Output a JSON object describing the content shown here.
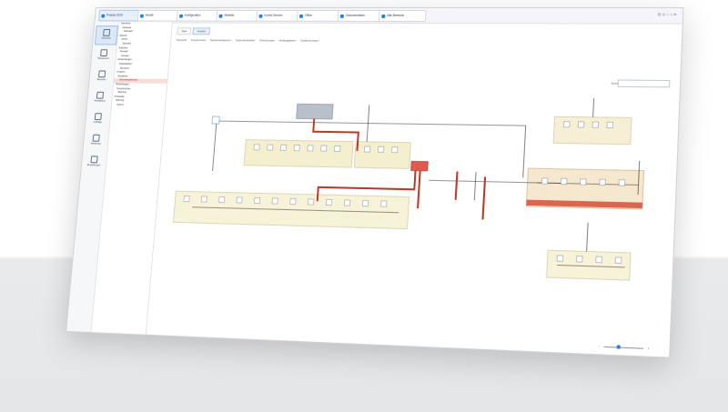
{
  "tabs": [
    {
      "label": "Produkt 2025",
      "active": true
    },
    {
      "label": "Modell"
    },
    {
      "label": "Konfiguration"
    },
    {
      "label": "Website"
    },
    {
      "label": "Kunde Service"
    },
    {
      "label": "Office"
    },
    {
      "label": "Dokumentation"
    },
    {
      "label": "Alle Bereiche"
    }
  ],
  "rail": [
    {
      "label": "Startseite",
      "icon": "home-icon",
      "selected": true
    },
    {
      "label": "Ressourcen",
      "icon": "grid-icon"
    },
    {
      "label": "Benutzer",
      "icon": "user-icon"
    },
    {
      "label": "Verwaltung",
      "icon": "folder-icon"
    },
    {
      "label": "Aufträge",
      "icon": "list-icon"
    },
    {
      "label": "Werkzeug",
      "icon": "tool-icon"
    },
    {
      "label": "Einstellungen",
      "icon": "gear-icon"
    }
  ],
  "tree": [
    {
      "label": "Standorte"
    },
    {
      "label": "Gebäude"
    },
    {
      "label": "Netzwerk"
    },
    {
      "label": "Räume"
    },
    {
      "label": "Server"
    },
    {
      "label": "Speicher"
    },
    {
      "label": "Switches"
    },
    {
      "label": "Firewall"
    },
    {
      "label": "Dienste"
    },
    {
      "label": "Anwendungen"
    },
    {
      "label": "Datenbanken"
    },
    {
      "label": "Benutzer"
    },
    {
      "label": "Gruppen"
    },
    {
      "label": "Richtlinien"
    },
    {
      "label": "Netzwerkübersicht",
      "highlight": true
    },
    {
      "label": "Verbindungen"
    },
    {
      "label": "Komponenten"
    },
    {
      "label": "Berichte"
    },
    {
      "label": "Protokolle"
    },
    {
      "label": "Wartung"
    },
    {
      "label": "Export"
    }
  ],
  "subtabs": [
    {
      "label": "Start"
    },
    {
      "label": "Ansicht",
      "on": true
    }
  ],
  "filters": [
    "Übersicht",
    "Komponenten",
    "Netzwerkdiagramm",
    "Systemarchitektur",
    "Verbindungen",
    "Abhängigkeiten",
    "Details anzeigen"
  ],
  "search": {
    "label": "Suche",
    "placeholder": ""
  },
  "zoom": {
    "level": 0.35
  }
}
